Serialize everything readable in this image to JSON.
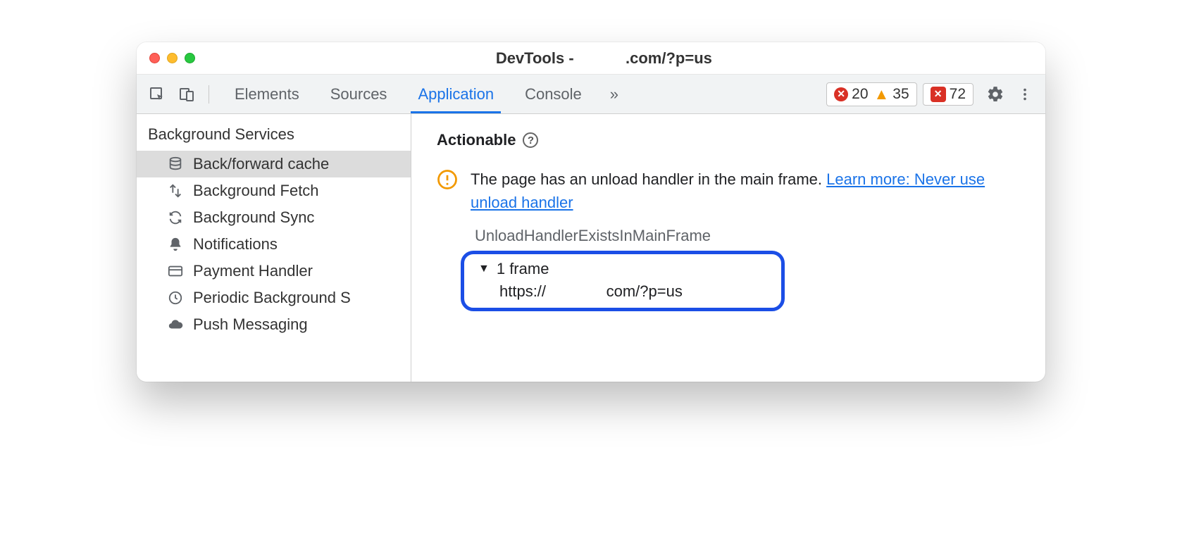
{
  "window": {
    "title_prefix": "DevTools - ",
    "title_suffix": ".com/?p=us"
  },
  "toolbar": {
    "tabs": [
      "Elements",
      "Sources",
      "Application",
      "Console"
    ],
    "active_tab_index": 2,
    "more_tabs_glyph": "»",
    "errors_count": "20",
    "warnings_count": "35",
    "issues_count": "72"
  },
  "sidebar": {
    "section_title": "Background Services",
    "items": [
      {
        "label": "Back/forward cache",
        "icon": "database",
        "selected": true
      },
      {
        "label": "Background Fetch",
        "icon": "transfer",
        "selected": false
      },
      {
        "label": "Background Sync",
        "icon": "sync",
        "selected": false
      },
      {
        "label": "Notifications",
        "icon": "bell",
        "selected": false
      },
      {
        "label": "Payment Handler",
        "icon": "card",
        "selected": false
      },
      {
        "label": "Periodic Background S",
        "icon": "clock",
        "selected": false
      },
      {
        "label": "Push Messaging",
        "icon": "cloud",
        "selected": false
      }
    ]
  },
  "main": {
    "section_heading": "Actionable",
    "diagnostic_text": "The page has an unload handler in the main frame. ",
    "learn_more": "Learn more: Never use unload handler",
    "reason_code": "UnloadHandlerExistsInMainFrame",
    "frame_count_label": "1 frame",
    "frame_url_prefix": "https://",
    "frame_url_suffix": "com/?p=us"
  }
}
